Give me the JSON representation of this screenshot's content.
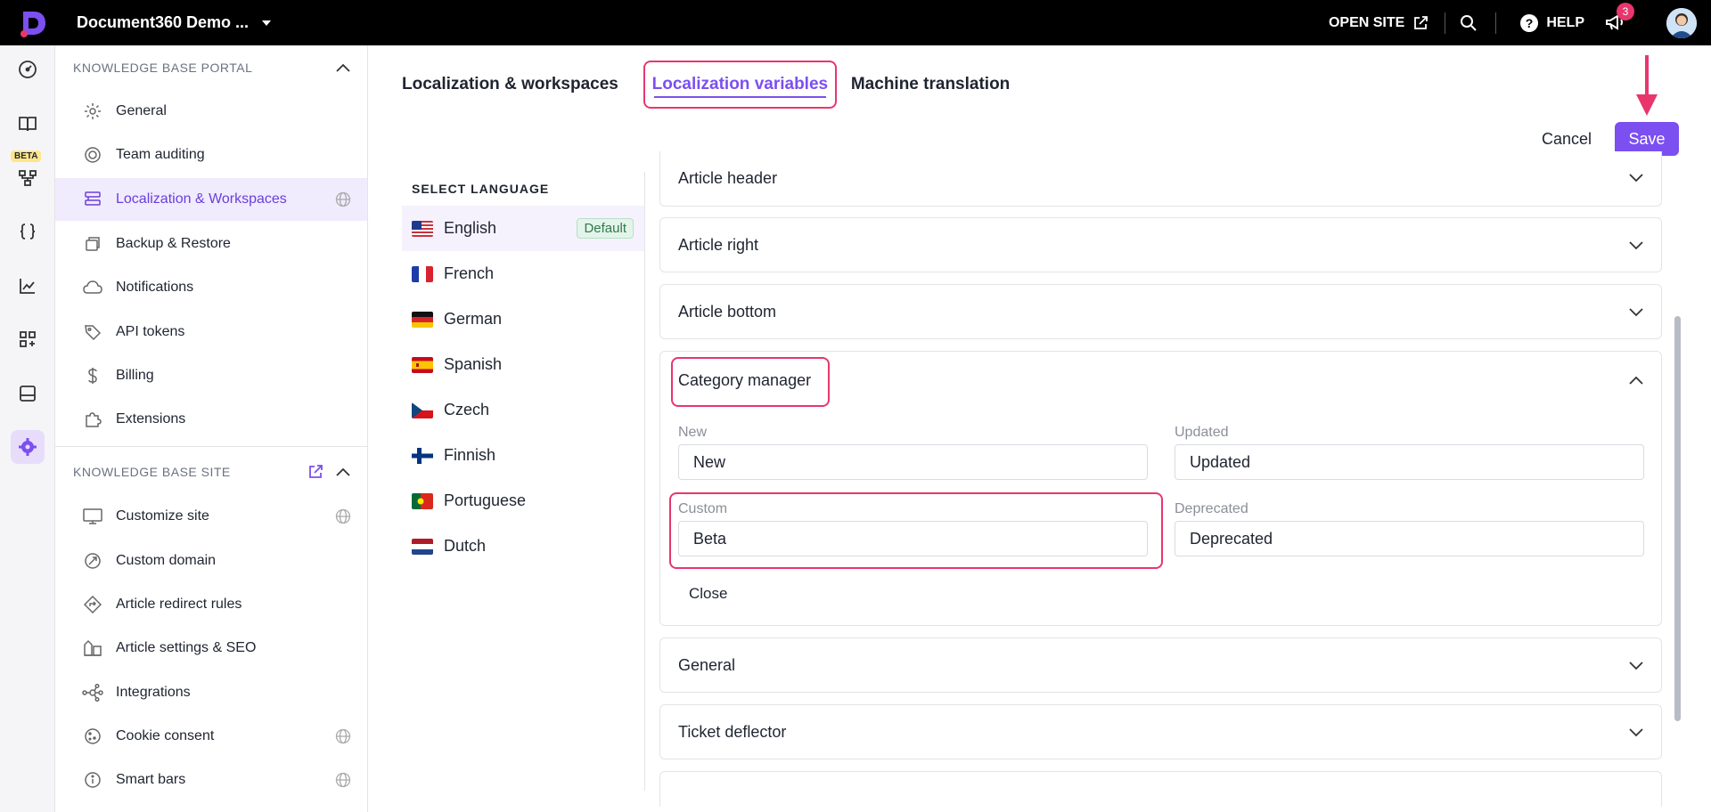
{
  "topbar": {
    "project_name": "Document360 Demo ...",
    "open_site_label": "OPEN SITE",
    "help_label": "HELP",
    "notification_count": "3"
  },
  "rail": {
    "beta_label": "BETA"
  },
  "sidebar": {
    "portal_heading": "KNOWLEDGE BASE PORTAL",
    "portal_items": [
      {
        "label": "General",
        "icon": "gear-icon"
      },
      {
        "label": "Team auditing",
        "icon": "audit-icon"
      },
      {
        "label": "Localization & Workspaces",
        "icon": "workspaces-icon"
      },
      {
        "label": "Backup & Restore",
        "icon": "backup-icon"
      },
      {
        "label": "Notifications",
        "icon": "cloud-bell-icon"
      },
      {
        "label": "API tokens",
        "icon": "tag-icon"
      },
      {
        "label": "Billing",
        "icon": "dollar-icon"
      },
      {
        "label": "Extensions",
        "icon": "puzzle-icon"
      }
    ],
    "site_heading": "KNOWLEDGE BASE SITE",
    "site_items": [
      {
        "label": "Customize site",
        "icon": "monitor-icon"
      },
      {
        "label": "Custom domain",
        "icon": "domain-icon"
      },
      {
        "label": "Article redirect rules",
        "icon": "redirect-icon"
      },
      {
        "label": "Article settings & SEO",
        "icon": "seo-icon"
      },
      {
        "label": "Integrations",
        "icon": "integrations-icon"
      },
      {
        "label": "Cookie consent",
        "icon": "cookie-icon"
      },
      {
        "label": "Smart bars",
        "icon": "info-icon"
      }
    ]
  },
  "tabs": {
    "tab1": "Localization & workspaces",
    "tab2": "Localization variables",
    "tab3": "Machine translation"
  },
  "actions": {
    "cancel": "Cancel",
    "save": "Save"
  },
  "languages": {
    "heading": "SELECT LANGUAGE",
    "default_badge": "Default",
    "items": [
      {
        "name": "English"
      },
      {
        "name": "French"
      },
      {
        "name": "German"
      },
      {
        "name": "Spanish"
      },
      {
        "name": "Czech"
      },
      {
        "name": "Finnish"
      },
      {
        "name": "Portuguese"
      },
      {
        "name": "Dutch"
      }
    ]
  },
  "sections": {
    "article_header": "Article header",
    "article_right": "Article right",
    "article_bottom": "Article bottom",
    "category_manager": "Category manager",
    "general": "General",
    "ticket_deflector": "Ticket deflector"
  },
  "category_fields": {
    "new_label": "New",
    "new_value": "New",
    "updated_label": "Updated",
    "updated_value": "Updated",
    "custom_label": "Custom",
    "custom_value": "Beta",
    "deprecated_label": "Deprecated",
    "deprecated_value": "Deprecated",
    "close_label": "Close"
  },
  "colors": {
    "accent": "#7c4ff0",
    "highlight": "#e8366d"
  }
}
